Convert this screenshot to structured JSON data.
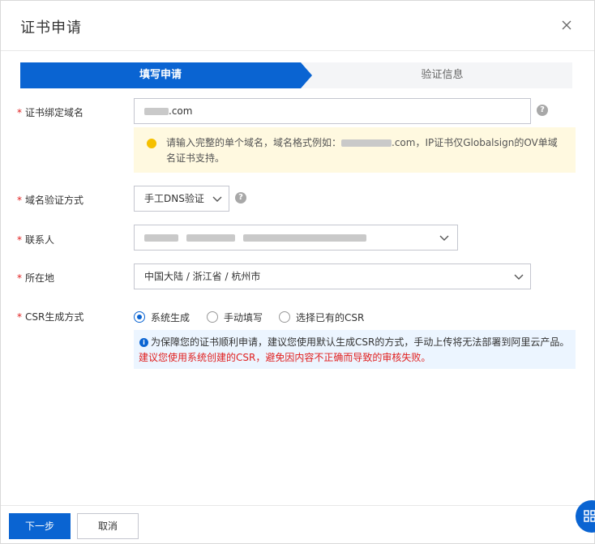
{
  "dialog": {
    "title": "证书申请",
    "close_icon": "close-icon"
  },
  "steps": {
    "step1": "填写申请",
    "step2": "验证信息"
  },
  "fields": {
    "domain": {
      "label": "证书绑定域名",
      "value_suffix": ".com"
    },
    "domain_tip": {
      "text_prefix": "请输入完整的单个域名，域名格式例如：",
      "text_middle": ".com，IP证书仅Globalsign的OV单域",
      "text_line2": "名证书支持。"
    },
    "verify_method": {
      "label": "域名验证方式",
      "value": "手工DNS验证"
    },
    "contact": {
      "label": "联系人"
    },
    "location": {
      "label": "所在地",
      "value": "中国大陆 / 浙江省 / 杭州市"
    },
    "csr": {
      "label": "CSR生成方式",
      "options": [
        "系统生成",
        "手动填写",
        "选择已有的CSR"
      ],
      "selected": "系统生成",
      "info_line1": "为保障您的证书顺利申请，建议您使用默认生成CSR的方式，手动上传将无法部署到阿里云产品。",
      "info_line2": "建议您使用系统创建的CSR，避免因内容不正确而导致的审核失败。"
    }
  },
  "footer": {
    "next_label": "下一步",
    "cancel_label": "取消"
  },
  "colors": {
    "primary": "#0a64d2",
    "required": "#e02020",
    "warning_bg": "#fff9e0",
    "info_bg": "#ecf5ff"
  }
}
